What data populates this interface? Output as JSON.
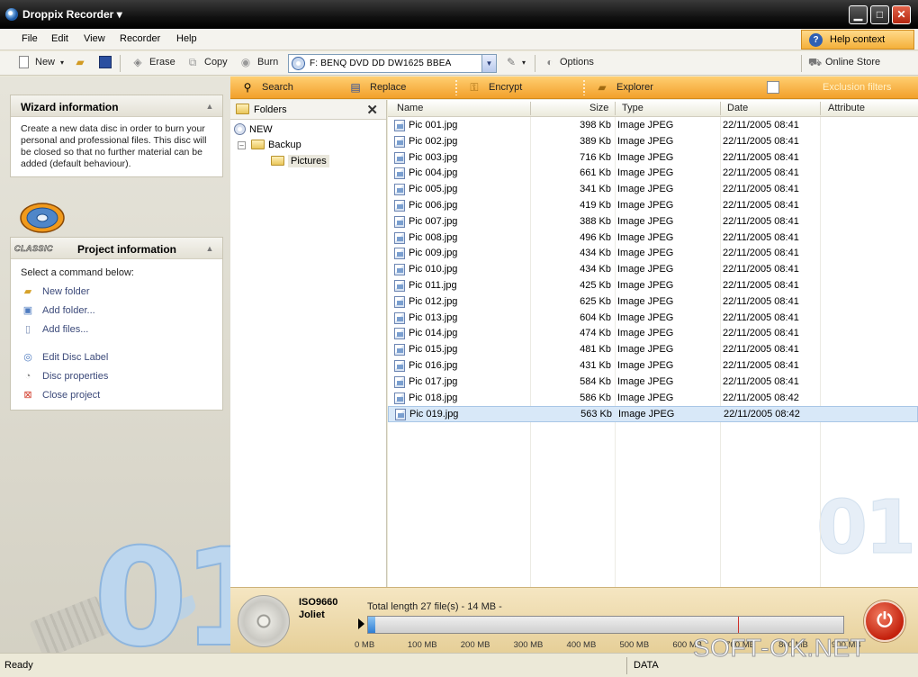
{
  "window": {
    "title": "Droppix Recorder ▾",
    "min": "▁",
    "max": "□",
    "close": "✕"
  },
  "menu": {
    "items": [
      "File",
      "Edit",
      "View",
      "Recorder",
      "Help"
    ],
    "help_context": "Help context"
  },
  "toolbar": {
    "new": "New",
    "new_arrow": "▾",
    "erase": "Erase",
    "copy": "Copy",
    "burn": "Burn",
    "drive": "F: BENQ    DVD DD DW1625   BBEA",
    "drive_arrow": "▼",
    "options": "Options",
    "online_store": "Online Store",
    "tools_arrow": "▾"
  },
  "actions": {
    "search": "Search",
    "replace": "Replace",
    "encrypt": "Encrypt",
    "explorer": "Explorer",
    "exclusion": "Exclusion filters"
  },
  "wizard": {
    "title": "Wizard information",
    "text": "Create a new data disc in order to burn your personal and professional files. This disc will be closed so that no further material can be added (default behaviour)."
  },
  "project": {
    "badge": "CLASSIC",
    "title": "Project information",
    "select": "Select a command below:",
    "items": [
      "New folder",
      "Add folder...",
      "Add files...",
      "Edit Disc Label",
      "Disc properties",
      "Close project"
    ]
  },
  "folders": {
    "title": "Folders",
    "close": "✕",
    "root": "NEW",
    "backup": "Backup",
    "pictures": "Pictures",
    "expander": "–"
  },
  "columns": {
    "name": "Name",
    "size": "Size",
    "type": "Type",
    "date": "Date",
    "attribute": "Attribute"
  },
  "files": [
    {
      "name": "Pic 001.jpg",
      "size": "398 Kb",
      "type": "Image JPEG",
      "date": "22/11/2005 08:41"
    },
    {
      "name": "Pic 002.jpg",
      "size": "389 Kb",
      "type": "Image JPEG",
      "date": "22/11/2005 08:41"
    },
    {
      "name": "Pic 003.jpg",
      "size": "716 Kb",
      "type": "Image JPEG",
      "date": "22/11/2005 08:41"
    },
    {
      "name": "Pic 004.jpg",
      "size": "661 Kb",
      "type": "Image JPEG",
      "date": "22/11/2005 08:41"
    },
    {
      "name": "Pic 005.jpg",
      "size": "341 Kb",
      "type": "Image JPEG",
      "date": "22/11/2005 08:41"
    },
    {
      "name": "Pic 006.jpg",
      "size": "419 Kb",
      "type": "Image JPEG",
      "date": "22/11/2005 08:41"
    },
    {
      "name": "Pic 007.jpg",
      "size": "388 Kb",
      "type": "Image JPEG",
      "date": "22/11/2005 08:41"
    },
    {
      "name": "Pic 008.jpg",
      "size": "496 Kb",
      "type": "Image JPEG",
      "date": "22/11/2005 08:41"
    },
    {
      "name": "Pic 009.jpg",
      "size": "434 Kb",
      "type": "Image JPEG",
      "date": "22/11/2005 08:41"
    },
    {
      "name": "Pic 010.jpg",
      "size": "434 Kb",
      "type": "Image JPEG",
      "date": "22/11/2005 08:41"
    },
    {
      "name": "Pic 011.jpg",
      "size": "425 Kb",
      "type": "Image JPEG",
      "date": "22/11/2005 08:41"
    },
    {
      "name": "Pic 012.jpg",
      "size": "625 Kb",
      "type": "Image JPEG",
      "date": "22/11/2005 08:41"
    },
    {
      "name": "Pic 013.jpg",
      "size": "604 Kb",
      "type": "Image JPEG",
      "date": "22/11/2005 08:41"
    },
    {
      "name": "Pic 014.jpg",
      "size": "474 Kb",
      "type": "Image JPEG",
      "date": "22/11/2005 08:41"
    },
    {
      "name": "Pic 015.jpg",
      "size": "481 Kb",
      "type": "Image JPEG",
      "date": "22/11/2005 08:41"
    },
    {
      "name": "Pic 016.jpg",
      "size": "431 Kb",
      "type": "Image JPEG",
      "date": "22/11/2005 08:41"
    },
    {
      "name": "Pic 017.jpg",
      "size": "584 Kb",
      "type": "Image JPEG",
      "date": "22/11/2005 08:41"
    },
    {
      "name": "Pic 018.jpg",
      "size": "586 Kb",
      "type": "Image JPEG",
      "date": "22/11/2005 08:42"
    },
    {
      "name": "Pic 019.jpg",
      "size": "563 Kb",
      "type": "Image JPEG",
      "date": "22/11/2005 08:42"
    }
  ],
  "selected_file_index": 18,
  "decor": {
    "big_label": "01"
  },
  "disc": {
    "fs1": "ISO9660",
    "fs2": "Joliet",
    "total": "Total length 27 file(s) - 14 MB -",
    "ticks": [
      "0 MB",
      "100 MB",
      "200 MB",
      "300 MB",
      "400 MB",
      "500 MB",
      "600 MB",
      "700 MB",
      "800 MB",
      "900 MB"
    ],
    "fill_mb": 14,
    "limit_mb": 700,
    "max_mb": 900,
    "power": "⏻"
  },
  "status": {
    "left": "Ready",
    "mode": "DATA"
  },
  "watermark": "SOFT-OK.NET",
  "colors": {
    "accent_orange": "#F2A02B",
    "selection": "#D8E8F8",
    "progress": "#2F7ED4",
    "power": "#C4210D"
  }
}
